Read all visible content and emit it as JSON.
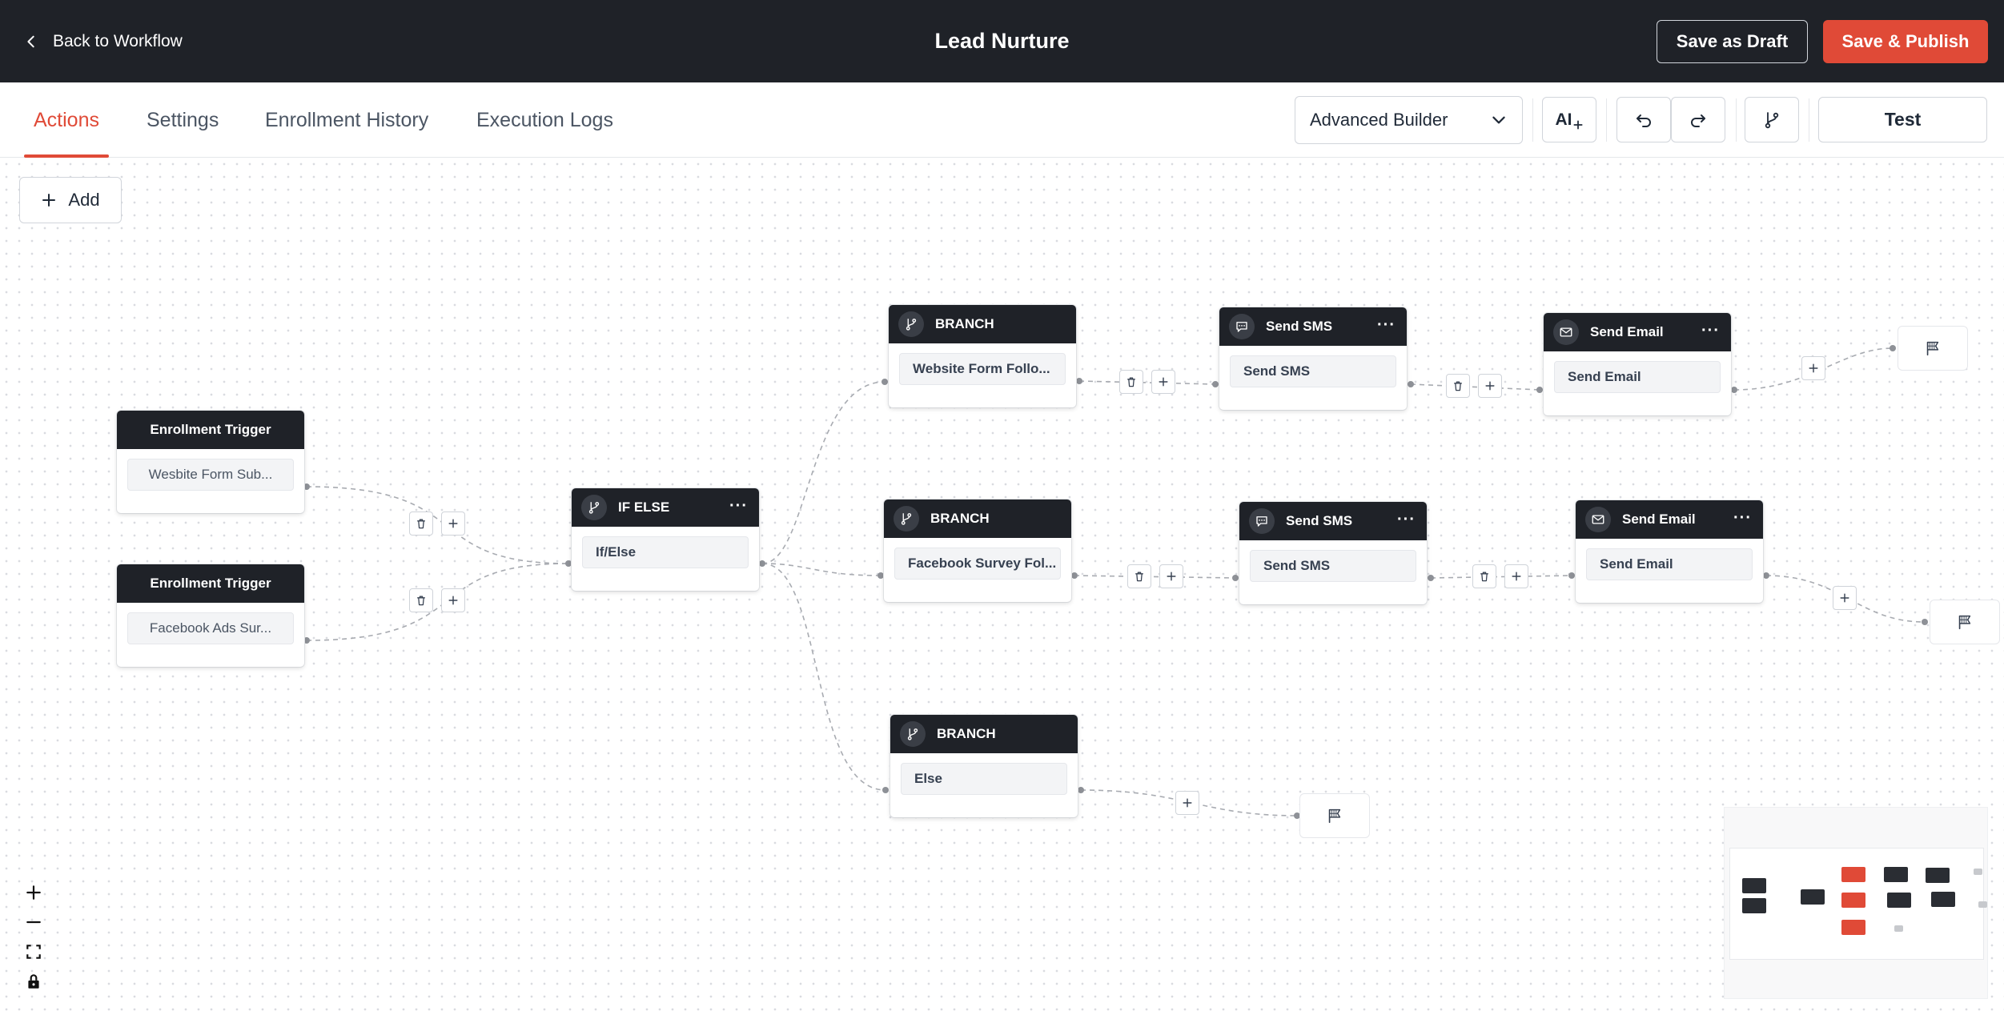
{
  "header": {
    "back_label": "Back to Workflow",
    "title": "Lead Nurture",
    "save_draft_label": "Save as Draft",
    "save_publish_label": "Save & Publish"
  },
  "tabs": [
    {
      "label": "Actions",
      "active": true
    },
    {
      "label": "Settings",
      "active": false
    },
    {
      "label": "Enrollment History",
      "active": false
    },
    {
      "label": "Execution Logs",
      "active": false
    }
  ],
  "toolbar": {
    "builder_mode": "Advanced Builder",
    "ai_label": "AI",
    "test_label": "Test"
  },
  "canvas": {
    "add_label": "Add",
    "triggers": [
      {
        "header": "Enrollment Trigger",
        "value": "Wesbite Form Sub..."
      },
      {
        "header": "Enrollment Trigger",
        "value": "Facebook Ads Sur..."
      }
    ],
    "if_else": {
      "header": "IF ELSE",
      "value": "If/Else"
    },
    "branches": [
      {
        "header": "BRANCH",
        "value": "Website Form Follo..."
      },
      {
        "header": "BRANCH",
        "value": "Facebook Survey Fol..."
      },
      {
        "header": "BRANCH",
        "value": "Else"
      }
    ],
    "actions": [
      {
        "header": "Send SMS",
        "value": "Send SMS"
      },
      {
        "header": "Send Email",
        "value": "Send Email"
      },
      {
        "header": "Send SMS",
        "value": "Send SMS"
      },
      {
        "header": "Send Email",
        "value": "Send Email"
      }
    ]
  },
  "colors": {
    "accent": "#e04a37",
    "dark": "#1f2228"
  }
}
